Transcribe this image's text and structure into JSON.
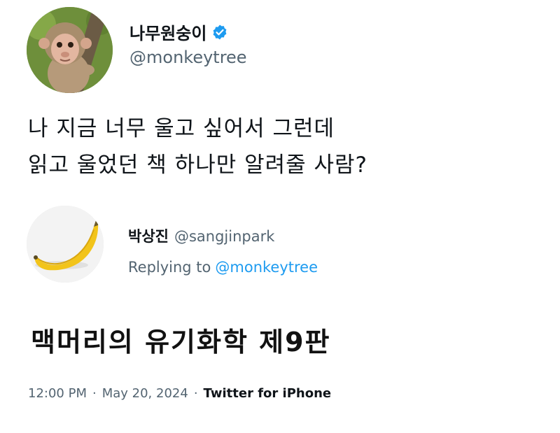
{
  "tweet": {
    "author": {
      "display_name": "나무원숭이",
      "handle": "@monkeytree",
      "verified": true,
      "avatar": "monkey-avatar"
    },
    "text_lines": [
      "나 지금 너무 울고 싶어서 그런데",
      "읽고 울었던 책 하나만 알려줄 사람?"
    ]
  },
  "reply": {
    "author": {
      "display_name": "박상진",
      "handle": "@sangjinpark",
      "avatar": "banana-avatar"
    },
    "replying_prefix": "Replying to",
    "replying_mention": "@monkeytree",
    "text": "맥머리의 유기화학 제9판"
  },
  "meta": {
    "time": "12:00 PM",
    "separator": "·",
    "date": "May 20, 2024",
    "source": "Twitter for iPhone"
  },
  "colors": {
    "link": "#1d9bf0",
    "secondary_text": "#536471",
    "verified_badge": "#1d9bf0"
  }
}
